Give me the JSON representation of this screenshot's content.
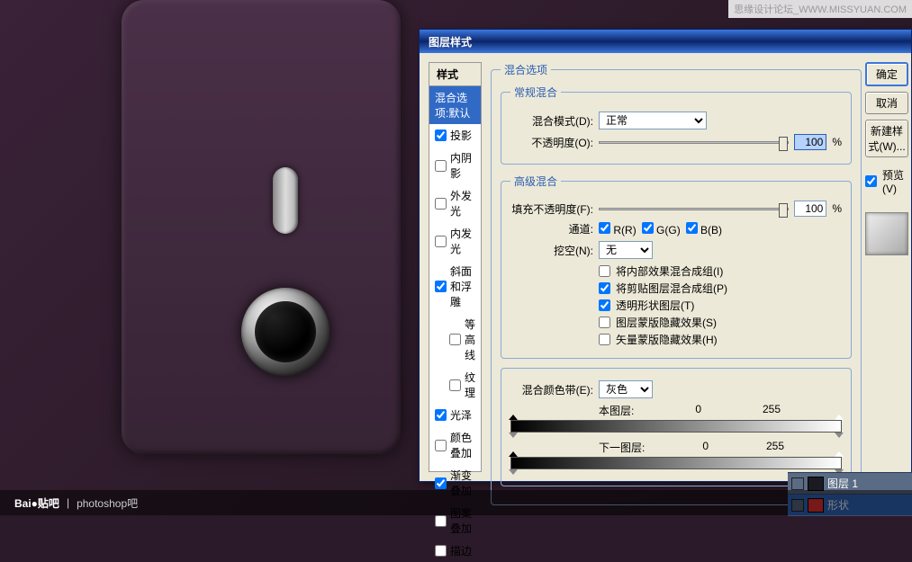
{
  "watermark": "思缘设计论坛_WWW.MISSYUAN.COM",
  "footer": {
    "logo": "Bai●贴吧",
    "sep": "|",
    "board": "photoshop吧"
  },
  "dialog": {
    "title": "图层样式",
    "styles_header": "样式",
    "styles": [
      {
        "label": "混合选项:默认",
        "selected": true,
        "checkbox": false
      },
      {
        "label": "投影",
        "checked": true
      },
      {
        "label": "内阴影",
        "checked": false
      },
      {
        "label": "外发光",
        "checked": false
      },
      {
        "label": "内发光",
        "checked": false
      },
      {
        "label": "斜面和浮雕",
        "checked": true
      },
      {
        "label": "等高线",
        "checked": false,
        "sub": true
      },
      {
        "label": "纹理",
        "checked": false,
        "sub": true
      },
      {
        "label": "光泽",
        "checked": true
      },
      {
        "label": "颜色叠加",
        "checked": false
      },
      {
        "label": "渐变叠加",
        "checked": true
      },
      {
        "label": "图案叠加",
        "checked": false
      },
      {
        "label": "描边",
        "checked": false
      }
    ],
    "buttons": {
      "ok": "确定",
      "cancel": "取消",
      "new_style": "新建样式(W)...",
      "preview": "预览(V)"
    },
    "blend_options": {
      "legend": "混合选项",
      "general": {
        "legend": "常规混合",
        "mode_label": "混合模式(D):",
        "mode_value": "正常",
        "opacity_label": "不透明度(O):",
        "opacity_value": "100",
        "pct": "%"
      },
      "advanced": {
        "legend": "高级混合",
        "fill_label": "填充不透明度(F):",
        "fill_value": "100",
        "pct": "%",
        "channels_label": "通道:",
        "r": "R(R)",
        "g": "G(G)",
        "b": "B(B)",
        "knockout_label": "挖空(N):",
        "knockout_value": "无",
        "opts": [
          {
            "label": "将内部效果混合成组(I)",
            "checked": false
          },
          {
            "label": "将剪贴图层混合成组(P)",
            "checked": true
          },
          {
            "label": "透明形状图层(T)",
            "checked": true
          },
          {
            "label": "图层蒙版隐藏效果(S)",
            "checked": false
          },
          {
            "label": "矢量蒙版隐藏效果(H)",
            "checked": false
          }
        ]
      },
      "blendif": {
        "label": "混合颜色带(E):",
        "value": "灰色",
        "this_layer": "本图层:",
        "this_lo": "0",
        "this_hi": "255",
        "under_layer": "下一图层:",
        "under_lo": "0",
        "under_hi": "255"
      }
    }
  },
  "layers": {
    "row1": "图层 1",
    "row2": "形状"
  }
}
